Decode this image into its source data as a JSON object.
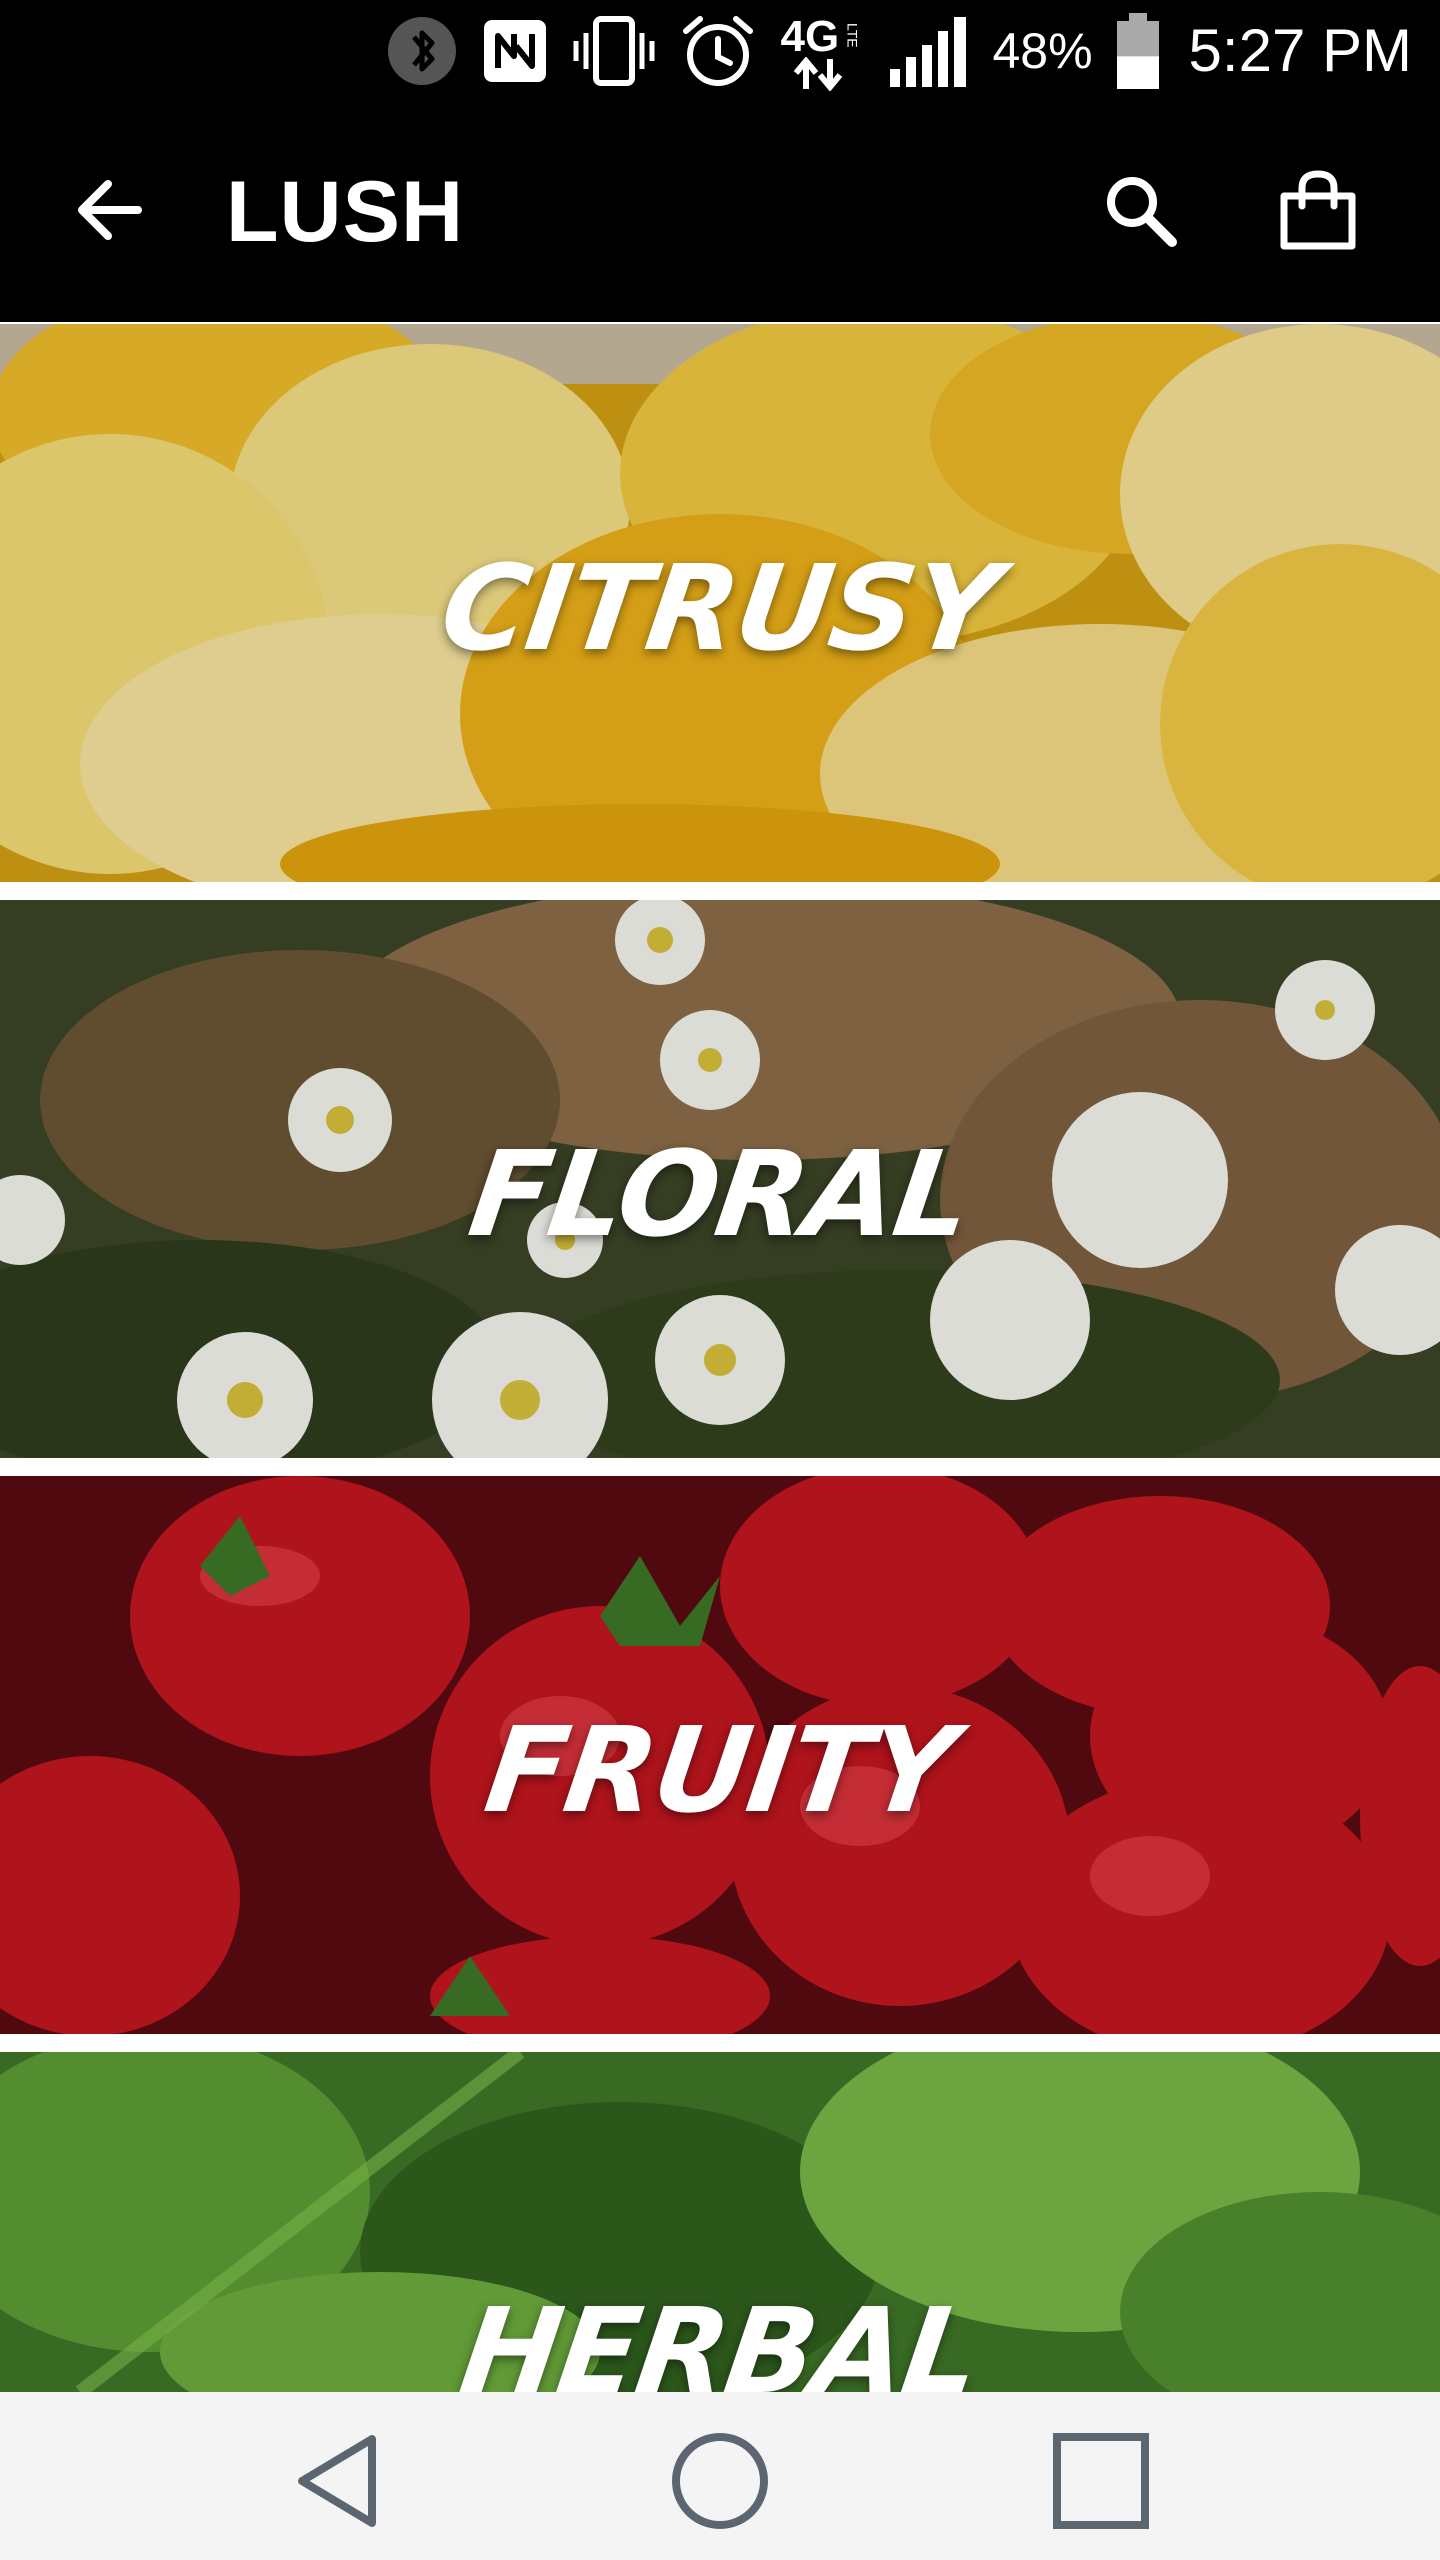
{
  "status_bar": {
    "icons": [
      "bluetooth-icon",
      "nfc-icon",
      "vibrate-icon",
      "alarm-icon",
      "lte-4g-icon",
      "signal-icon",
      "battery-icon"
    ],
    "network_label": "4G",
    "network_sub_label": "LTE",
    "battery_percent": "48%",
    "battery_level": 0.48,
    "time": "5:27 PM"
  },
  "toolbar": {
    "title": "LUSH",
    "back_icon": "arrow-back-icon",
    "search_icon": "search-icon",
    "bag_icon": "shopping-bag-icon"
  },
  "categories": [
    {
      "label": "CITRUSY",
      "theme": "lemons",
      "colors": [
        "#f2c12e",
        "#fbe27a",
        "#d89a10"
      ]
    },
    {
      "label": "FLORAL",
      "theme": "white-daisies",
      "colors": [
        "#3e4a2a",
        "#8a6b45",
        "#ffffff"
      ]
    },
    {
      "label": "FRUITY",
      "theme": "strawberries",
      "colors": [
        "#b5121b",
        "#e0303a",
        "#5a0a10"
      ]
    },
    {
      "label": "HERBAL",
      "theme": "green-herbs",
      "colors": [
        "#3f7a2a",
        "#6fae3e",
        "#2b5a1c"
      ]
    }
  ],
  "nav_bar": {
    "icons": [
      "nav-back-triangle-icon",
      "nav-home-circle-icon",
      "nav-recents-square-icon"
    ]
  }
}
